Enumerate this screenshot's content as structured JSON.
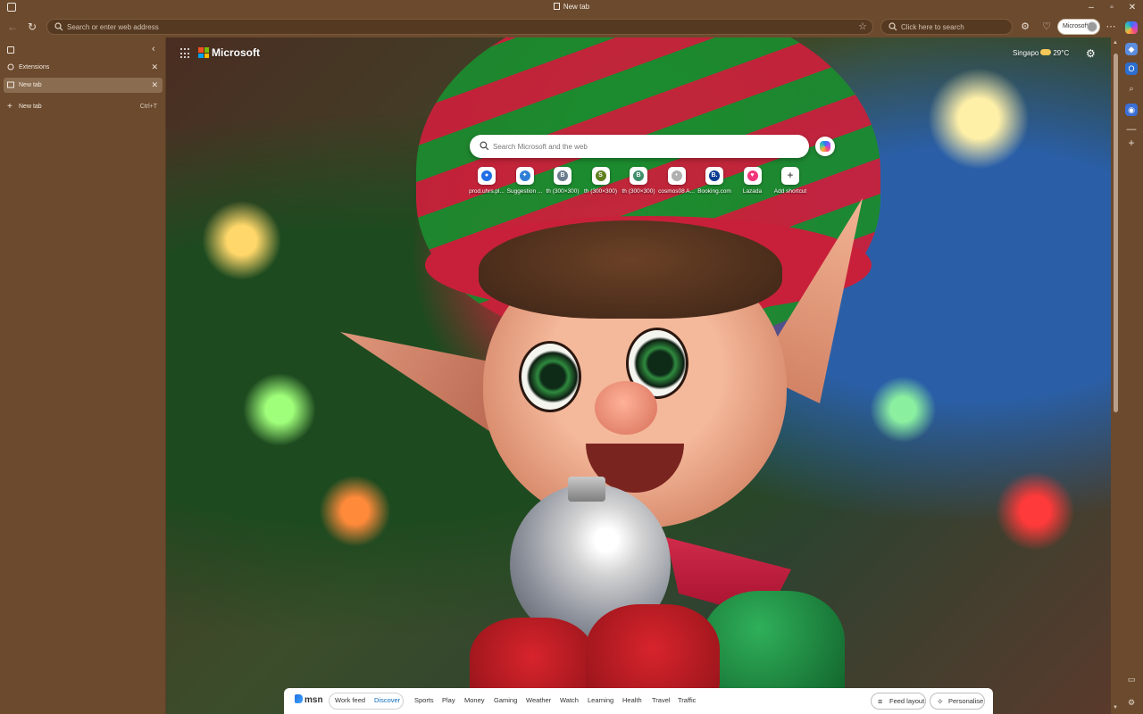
{
  "window": {
    "title": "New tab",
    "controls": {
      "minimize": "–",
      "maximize": "▫",
      "close": "✕"
    }
  },
  "toolbar": {
    "address_placeholder": "Search or enter web address",
    "search_placeholder": "Click here to search",
    "profile_label": "Microsoft"
  },
  "sidebar": {
    "tabs": [
      {
        "label": "Extensions",
        "active": false,
        "icon": "extensions-icon"
      },
      {
        "label": "New tab",
        "active": true,
        "icon": "new-tab-page-icon"
      }
    ],
    "new_tab": {
      "label": "New tab",
      "shortcut": "Ctrl+T"
    }
  },
  "ntp": {
    "brand": "Microsoft",
    "weather": {
      "location": "Singapo",
      "temperature": "29°C"
    },
    "search_placeholder": "Search Microsoft and the web",
    "quick_links": [
      {
        "label": "prod.uhrs.pl...",
        "icon_color": "#1e6fe6",
        "glyph": "●"
      },
      {
        "label": "Suggestion ...",
        "icon_color": "#2f7fd6",
        "glyph": "✦"
      },
      {
        "label": "th (300×300)",
        "icon_color": "#6b7b8c",
        "glyph": "B"
      },
      {
        "label": "th (300×300)",
        "icon_color": "#5f7f1e",
        "glyph": "S"
      },
      {
        "label": "th (300×300)",
        "icon_color": "#3e8f6a",
        "glyph": "B"
      },
      {
        "label": "cosmos08 A...",
        "icon_color": "#b0b0b0",
        "glyph": "•"
      },
      {
        "label": "Booking.com",
        "icon_color": "#0b3d91",
        "glyph": "B."
      },
      {
        "label": "Lazada",
        "icon_color": "#f2357a",
        "glyph": "♥"
      },
      {
        "label": "Add shortcut",
        "icon_color": "#ffffff",
        "glyph": "+"
      }
    ]
  },
  "msn": {
    "logo": "msn",
    "tabs": [
      "Work feed",
      "Discover",
      "Sports",
      "Play",
      "Money",
      "Gaming",
      "Weather",
      "Watch",
      "Learning",
      "Health",
      "Travel",
      "Traffic"
    ],
    "active_tab": "Discover",
    "feed_layout": "Feed layout",
    "personalise": "Personalise"
  },
  "colors": {
    "chrome": "#6b4a2e",
    "accent": "#0f6cbd"
  }
}
